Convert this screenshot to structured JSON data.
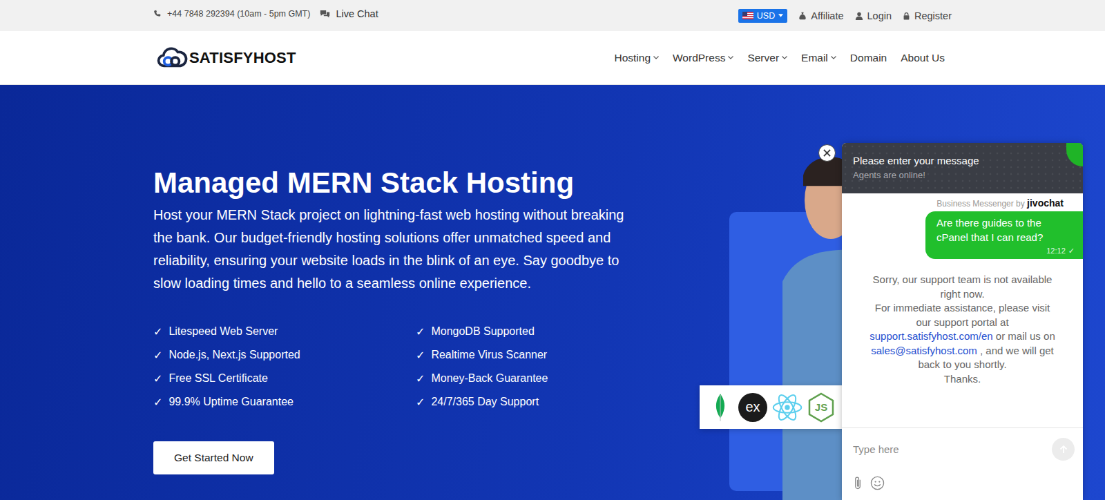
{
  "topbar": {
    "phone": "+44 7848 292394 (10am - 5pm GMT)",
    "live_chat": "Live Chat",
    "currency": "USD",
    "links": [
      {
        "label": "Affiliate",
        "kind": "affiliate"
      },
      {
        "label": "Login",
        "kind": "login"
      },
      {
        "label": "Register",
        "kind": "register"
      }
    ]
  },
  "logo": {
    "text": "SATISFYHOST"
  },
  "nav": [
    {
      "label": "Hosting",
      "dropdown": true
    },
    {
      "label": "WordPress",
      "dropdown": true
    },
    {
      "label": "Server",
      "dropdown": true
    },
    {
      "label": "Email",
      "dropdown": true
    },
    {
      "label": "Domain",
      "dropdown": false
    },
    {
      "label": "About Us",
      "dropdown": false
    }
  ],
  "hero": {
    "title": "Managed MERN Stack Hosting",
    "description": "Host your MERN Stack project on lightning-fast web hosting without breaking the bank. Our budget-friendly hosting solutions offer unmatched speed and reliability, ensuring your website loads in the blink of an eye. Say goodbye to slow loading times and hello to a seamless online experience.",
    "feature_mark": "✓",
    "feature_columns": [
      [
        "Litespeed Web Server",
        "Node.js, Next.js Supported",
        "Free SSL Certificate",
        "99.9% Uptime Guarantee"
      ],
      [
        "MongoDB Supported",
        "Realtime Virus Scanner",
        "Money-Back Guarantee",
        "24/7/365 Day Support"
      ]
    ],
    "button": "Get Started Now",
    "tech_logos": [
      {
        "kind": "mongodb",
        "text": ""
      },
      {
        "kind": "express",
        "text": "ex"
      },
      {
        "kind": "react",
        "text": ""
      },
      {
        "kind": "node",
        "text": "JS"
      }
    ]
  },
  "chat": {
    "header_title": "Please enter your message",
    "header_status": "Agents are online!",
    "branding": "Business Messenger by",
    "brand": "jivochat",
    "messages": [
      {
        "text": "Are there guides to the cPanel that I can read?",
        "time": "12:12",
        "read": true,
        "read_mark": "✓"
      }
    ],
    "notice": [
      {
        "parts": [
          {
            "text": "Sorry, our support team is not available right now.",
            "link": false
          }
        ]
      },
      {
        "parts": [
          {
            "text": "For immediate assistance, please visit our support portal at ",
            "link": false
          },
          {
            "text": "support.satisfyhost.com/en",
            "link": true
          },
          {
            "text": " or mail us on ",
            "link": false
          },
          {
            "text": "sales@satisfyhost.com",
            "link": true
          },
          {
            "text": " , and we will get back to you shortly.",
            "link": false
          }
        ]
      },
      {
        "parts": [
          {
            "text": "Thanks.",
            "link": false
          }
        ]
      }
    ],
    "input_placeholder": "Type here"
  }
}
